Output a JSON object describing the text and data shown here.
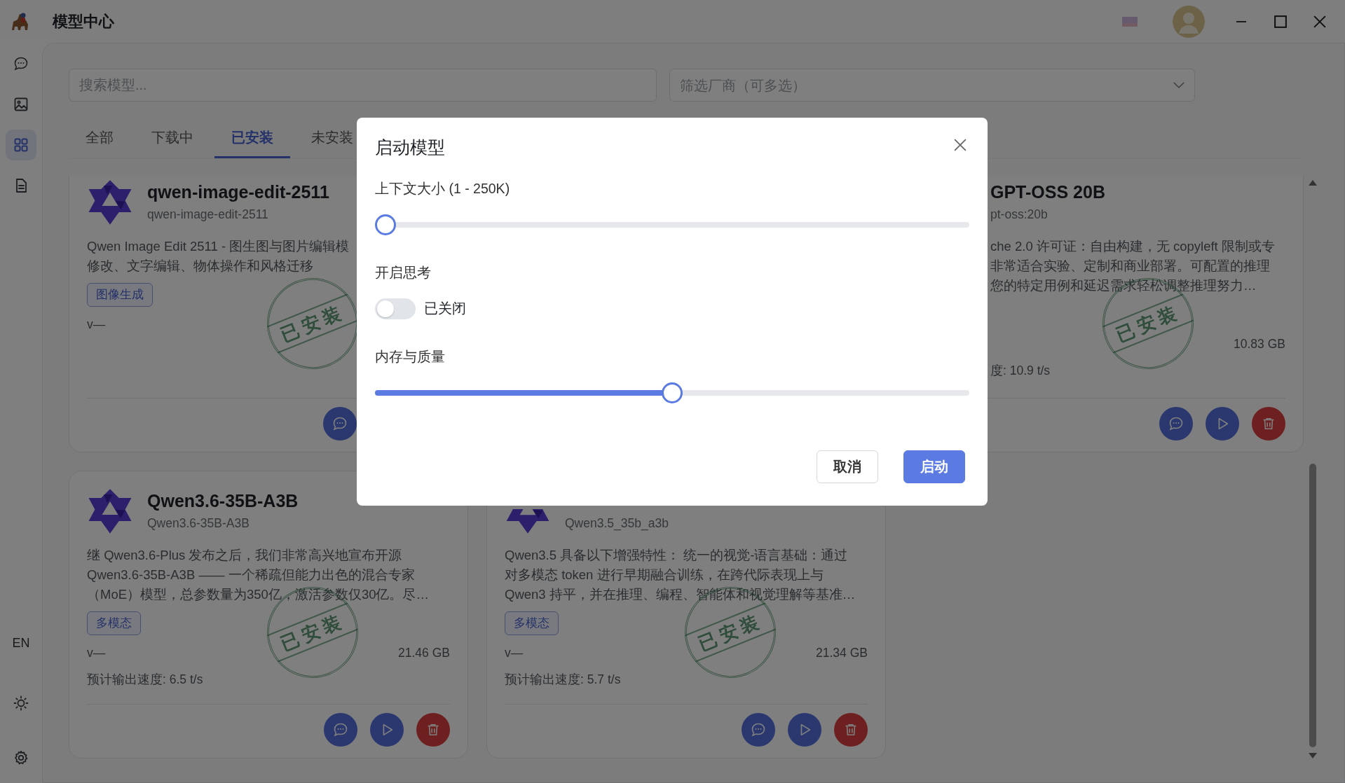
{
  "window": {
    "title": "模型中心",
    "language_button": "EN"
  },
  "sidebar": {
    "items": [
      {
        "selected": false
      },
      {
        "selected": false
      },
      {
        "selected": true
      },
      {
        "selected": false
      }
    ]
  },
  "search": {
    "placeholder": "搜索模型..."
  },
  "vendor_filter": {
    "placeholder": "筛选厂商（可多选）"
  },
  "tabs": [
    {
      "label": "全部",
      "selected": false
    },
    {
      "label": "下载中",
      "selected": false
    },
    {
      "label": "已安装",
      "selected": true
    },
    {
      "label": "未安装",
      "selected": false
    }
  ],
  "cards": [
    {
      "title": "qwen-image-edit-2511",
      "subtitle": "qwen-image-edit-2511",
      "description_lines": [
        "Qwen Image Edit 2511 - 图生图与图片编辑模",
        "修改、文字编辑、物体操作和风格迁移"
      ],
      "tag": "图像生成",
      "version": "v—",
      "stamp": "已安装",
      "actions": [
        {
          "kind": "chat"
        }
      ]
    },
    {
      "title": "GPT-OSS 20B",
      "subtitle": "pt-oss:20b",
      "description_lines": [
        "che 2.0 许可证：自由构建，无 copyleft 限制或专",
        "非常适合实验、定制和商业部署。可配置的推理",
        "您的特定用例和延迟需求轻松调整推理努力…"
      ],
      "size": "10.83 GB",
      "speed": "度: 10.9 t/s",
      "stamp": "已安装",
      "actions": [
        {
          "kind": "chat"
        },
        {
          "kind": "play"
        },
        {
          "kind": "delete"
        }
      ]
    },
    {
      "title": "Qwen3.6-35B-A3B",
      "subtitle": "Qwen3.6-35B-A3B",
      "description_lines": [
        "继 Qwen3.6-Plus 发布之后，我们非常高兴地宣布开源",
        "Qwen3.6-35B-A3B —— 一个稀疏但能力出色的混合专家",
        "（MoE）模型，总参数量为350亿，激活参数仅30亿。尽…"
      ],
      "tag": "多模态",
      "version": "v—",
      "size": "21.46 GB",
      "speed": "预计输出速度: 6.5 t/s",
      "stamp": "已安装",
      "actions": [
        {
          "kind": "chat"
        },
        {
          "kind": "play"
        },
        {
          "kind": "delete"
        }
      ]
    },
    {
      "subtitle": "Qwen3.5_35b_a3b",
      "description_lines": [
        "Qwen3.5 具备以下增强特性： 统一的视觉-语言基础：通过",
        "对多模态 token 进行早期融合训练，在跨代际表现上与",
        "Qwen3 持平，并在推理、编程、智能体和视觉理解等基准…"
      ],
      "tag": "多模态",
      "version": "v—",
      "size": "21.34 GB",
      "speed": "预计输出速度: 5.7 t/s",
      "stamp": "已安装",
      "actions": [
        {
          "kind": "chat"
        },
        {
          "kind": "play"
        },
        {
          "kind": "delete"
        }
      ]
    }
  ],
  "dialog": {
    "title": "启动模型",
    "fields": [
      {
        "kind": "slider",
        "label": "上下文大小 (1 - 250K)",
        "level": 0
      },
      {
        "kind": "toggle",
        "label": "开启思考",
        "on": false,
        "state_text": "已关闭"
      },
      {
        "kind": "slider",
        "label": "内存与质量",
        "level": 0.5
      }
    ],
    "buttons": [
      {
        "label": "取消",
        "kind": "secondary"
      },
      {
        "label": "启动",
        "kind": "primary"
      }
    ]
  }
}
